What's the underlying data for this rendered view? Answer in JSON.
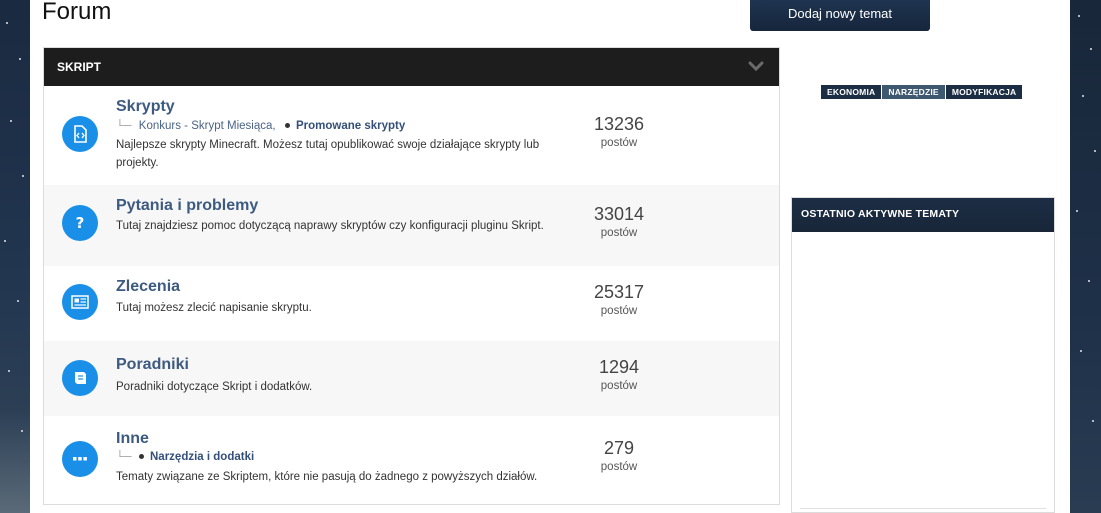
{
  "page": {
    "title": "Forum"
  },
  "toolbar": {
    "new_topic_label": "Dodaj nowy temat"
  },
  "category": {
    "name": "SKRIPT",
    "forums": [
      {
        "title": "Skrypty",
        "icon": "script-icon",
        "subforums": [
          "Konkurs - Skrypt Miesiąca,",
          "Promowane skrypty"
        ],
        "description": "Najlepsze skrypty Minecraft. Możesz tutaj opublikować swoje działające skrypty lub projekty.",
        "count": "13236",
        "count_label": "postów"
      },
      {
        "title": "Pytania i problemy",
        "icon": "question-icon",
        "subforums": [],
        "description": "Tutaj znajdziesz pomoc dotyczącą naprawy skryptów czy konfiguracji pluginu Skript.",
        "count": "33014",
        "count_label": "postów"
      },
      {
        "title": "Zlecenia",
        "icon": "newspaper-icon",
        "subforums": [],
        "description": "Tutaj możesz zlecić napisanie skryptu.",
        "count": "25317",
        "count_label": "postów"
      },
      {
        "title": "Poradniki",
        "icon": "book-icon",
        "subforums": [],
        "description": "Poradniki dotyczące Skript i dodatków.",
        "count": "1294",
        "count_label": "postów"
      },
      {
        "title": "Inne",
        "icon": "ellipsis-icon",
        "subforums": [
          "Narzędzia i dodatki"
        ],
        "description": "Tematy związane ze Skriptem, które nie pasują do żadnego z powyższych działów.",
        "count": "279",
        "count_label": "postów"
      }
    ]
  },
  "sidebar": {
    "tags": [
      "EKONOMIA",
      "NARZĘDZIE",
      "MODYFIKACJA"
    ],
    "recent_topics_title": "OSTATNIO AKTYWNE TEMATY"
  },
  "colors": {
    "accent_blue": "#1a8fe8",
    "link": "#3d5a80",
    "header_dark": "#1d1d1d",
    "navy": "#1c2e44"
  }
}
